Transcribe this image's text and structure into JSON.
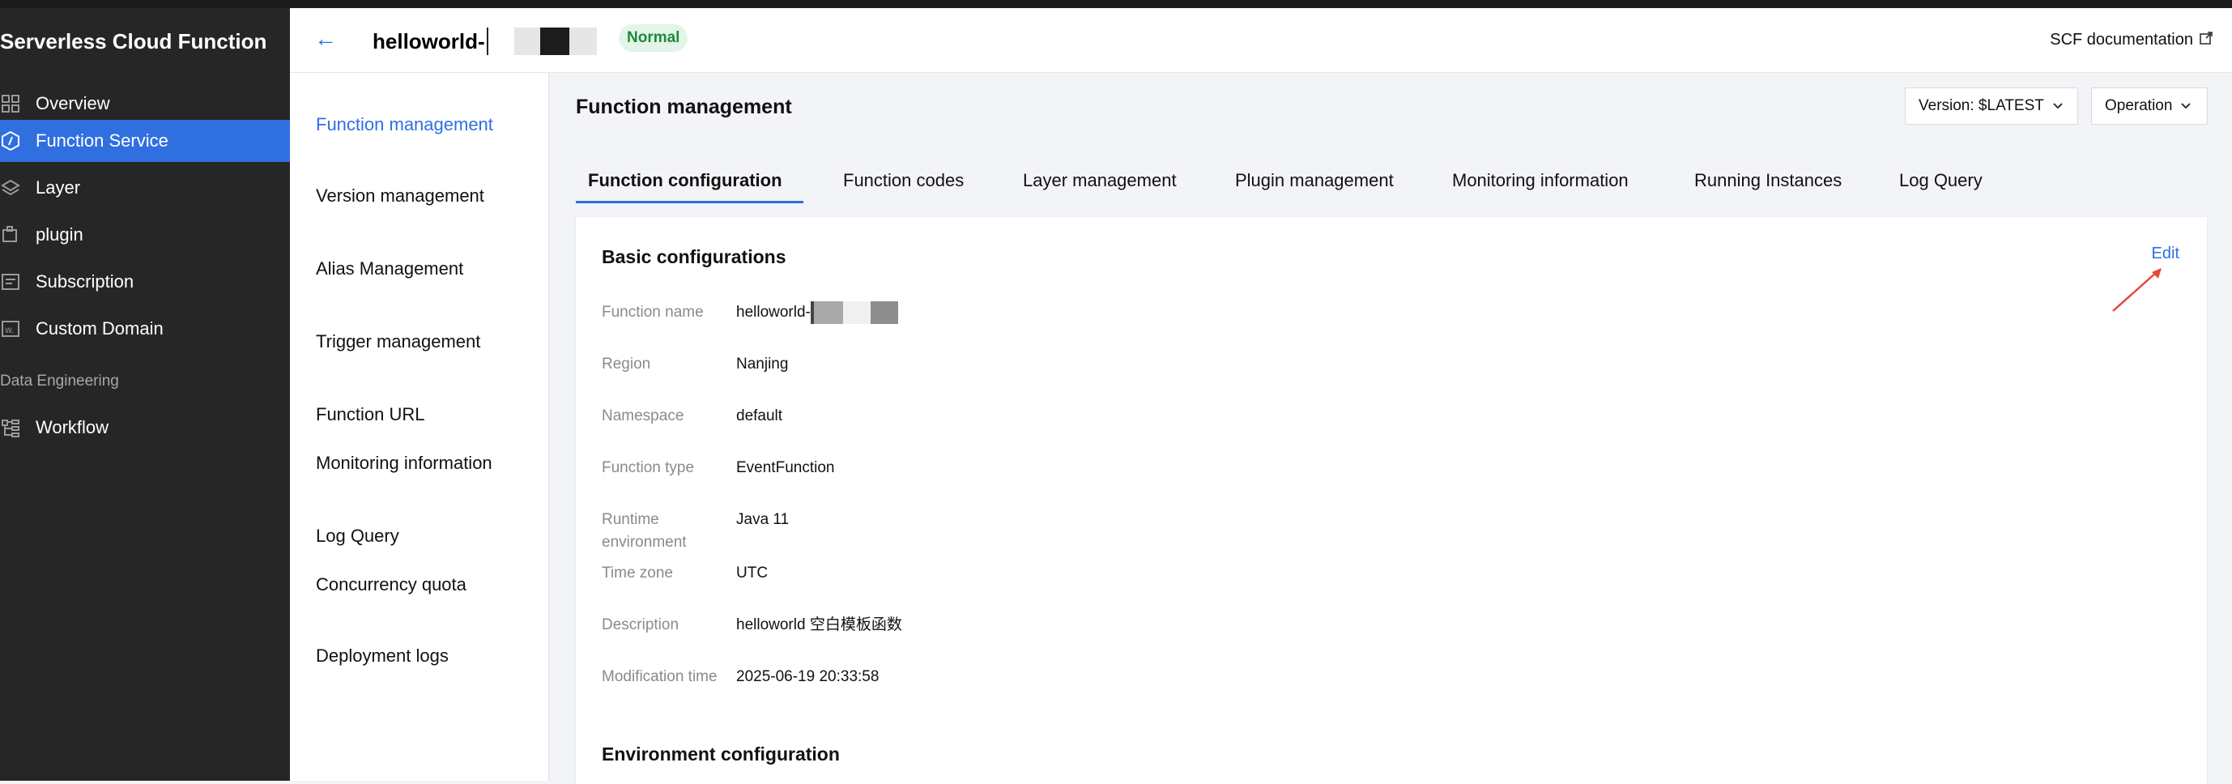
{
  "sidebar": {
    "title": "Serverless Cloud Function",
    "items": [
      {
        "label": "Overview",
        "icon": "grid-icon"
      },
      {
        "label": "Function Service",
        "icon": "function-icon"
      },
      {
        "label": "Layer",
        "icon": "layers-icon"
      },
      {
        "label": "plugin",
        "icon": "plugin-icon"
      },
      {
        "label": "Subscription",
        "icon": "subscription-icon"
      },
      {
        "label": "Custom Domain",
        "icon": "domain-icon"
      }
    ],
    "section": "Data Engineering",
    "section_items": [
      {
        "label": "Workflow",
        "icon": "workflow-icon"
      }
    ],
    "active_index": 1
  },
  "header": {
    "back": "←",
    "function_name": "helloworld-",
    "status": "Normal",
    "doc_link": "SCF documentation",
    "doc_icon": "external-link-icon"
  },
  "subnav": {
    "items": [
      "Function management",
      "Version management",
      "Alias Management",
      "Trigger management",
      "Function URL",
      "Monitoring information",
      "Log Query",
      "Concurrency quota",
      "Deployment logs"
    ],
    "active_index": 0
  },
  "main": {
    "title": "Function management",
    "version_dropdown": "Version: $LATEST",
    "operation_dropdown": "Operation",
    "tabs": [
      "Function configuration",
      "Function codes",
      "Layer management",
      "Plugin management",
      "Monitoring information",
      "Running Instances",
      "Log Query"
    ],
    "active_tab": 0,
    "card": {
      "title": "Basic configurations",
      "edit": "Edit",
      "rows": [
        {
          "label": "Function name",
          "value": "helloworld-"
        },
        {
          "label": "Region",
          "value": "Nanjing"
        },
        {
          "label": "Namespace",
          "value": "default"
        },
        {
          "label": "Function type",
          "value": "EventFunction"
        },
        {
          "label": "Runtime environment",
          "value": "Java 11"
        },
        {
          "label": "Time zone",
          "value": "UTC"
        },
        {
          "label": "Description",
          "value": "helloworld 空白模板函数"
        },
        {
          "label": "Modification time",
          "value": "2025-06-19 20:33:58"
        }
      ],
      "next_section": "Environment configuration"
    }
  },
  "colors": {
    "accent": "#2f6fe0",
    "sidebar_bg": "#262626",
    "status_bg": "#e3f4e8",
    "status_text": "#1f8a3b",
    "annotation_arrow": "#e8463a"
  }
}
